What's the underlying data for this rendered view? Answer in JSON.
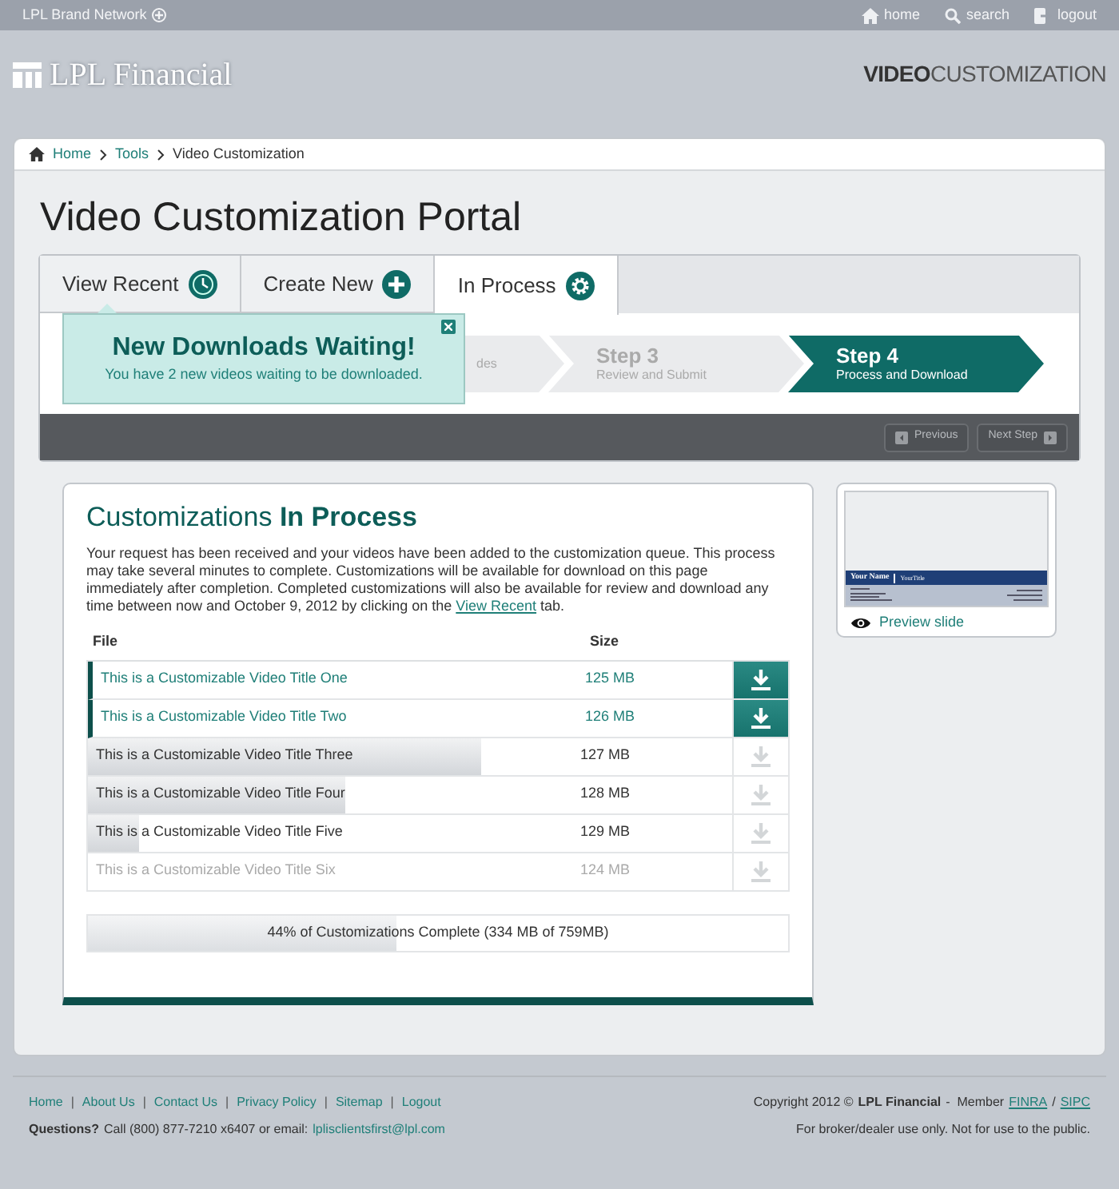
{
  "top_bar": {
    "brand": "LPL Brand Network",
    "links": [
      {
        "kind": "home",
        "label": "home"
      },
      {
        "kind": "search",
        "label": "search"
      },
      {
        "kind": "logout",
        "label": "logout"
      }
    ]
  },
  "header": {
    "logo": "LPL Financial",
    "app_title_bold": "VIDEO",
    "app_title_rest": "CUSTOMIZATION"
  },
  "breadcrumb": [
    "Home",
    "Tools",
    "Video Customization"
  ],
  "page_title": "Video Customization Portal",
  "tabs": [
    {
      "label": "View Recent",
      "kind": "recent",
      "selected": false
    },
    {
      "label": "Create New",
      "kind": "create",
      "selected": false
    },
    {
      "label": "In Process",
      "kind": "process",
      "selected": true
    }
  ],
  "popup": {
    "title": "New Downloads Waiting!",
    "message": "You have 2 new videos waiting to be downloaded."
  },
  "steps": [
    {
      "subtitle": "des",
      "selected": false
    },
    {
      "title": "Step 3",
      "subtitle": "Review and Submit",
      "selected": false
    },
    {
      "title": "Step 4",
      "subtitle": "Process and Download",
      "selected": true
    }
  ],
  "nav_buttons": [
    {
      "kind": "previous",
      "label": "Previous"
    },
    {
      "kind": "next",
      "label": "Next Step"
    }
  ],
  "panel": {
    "title": "Customizations",
    "title_bold": "In Process",
    "intro": "Your request has been received and your videos have been added to the customization queue.  This process may take several minutes to complete.  Customizations will be available for download on this page immediately after completion.  Completed customizations will also be available for review and download any time between now and October 9, 2012 by clicking on the",
    "intro_link": "View Recent",
    "intro_end": "tab.",
    "columns": [
      "File",
      "Size"
    ],
    "files": [
      {
        "name": "This is a Customizable Video Title One",
        "size": "125 MB",
        "ready": true,
        "disabled": false
      },
      {
        "name": "This is a Customizable Video Title Two",
        "size": "126 MB",
        "ready": true,
        "disabled": false
      },
      {
        "name": "This is a Customizable Video Title Three",
        "size": "127 MB",
        "ready": false,
        "disabled": false,
        "level": 0.61
      },
      {
        "name": "This is a Customizable Video Title Four",
        "size": "128 MB",
        "ready": false,
        "disabled": false,
        "level": 0.4
      },
      {
        "name": "This is a Customizable Video Title Five",
        "size": "129 MB",
        "ready": false,
        "disabled": false,
        "level": 0.08
      },
      {
        "name": "This is a Customizable Video Title Six",
        "size": "124 MB",
        "ready": false,
        "disabled": true
      }
    ],
    "progress": {
      "level": 0.44,
      "label": "44% of Customizations Complete (334 MB of 759MB)"
    }
  },
  "preview": {
    "slide_name": "Your Name",
    "slide_title": "YourTitle",
    "link": "Preview slide"
  },
  "footer": {
    "links": [
      "Home",
      "About Us",
      "Contact Us",
      "Privacy Policy",
      "Sitemap",
      "Logout"
    ],
    "separator": "|",
    "questions_label": "Questions?",
    "questions_text": "Call (800) 877-7210 x6407 or email:",
    "email": "lplisclientsfirst@lpl.com",
    "copyright": "Copyright 2012 ©",
    "company": "LPL Financial",
    "member": "-  Member",
    "member_links": [
      "FINRA",
      "SIPC"
    ],
    "member_separator": "/",
    "disclaimer": "For broker/dealer use only. Not for use to the public."
  }
}
